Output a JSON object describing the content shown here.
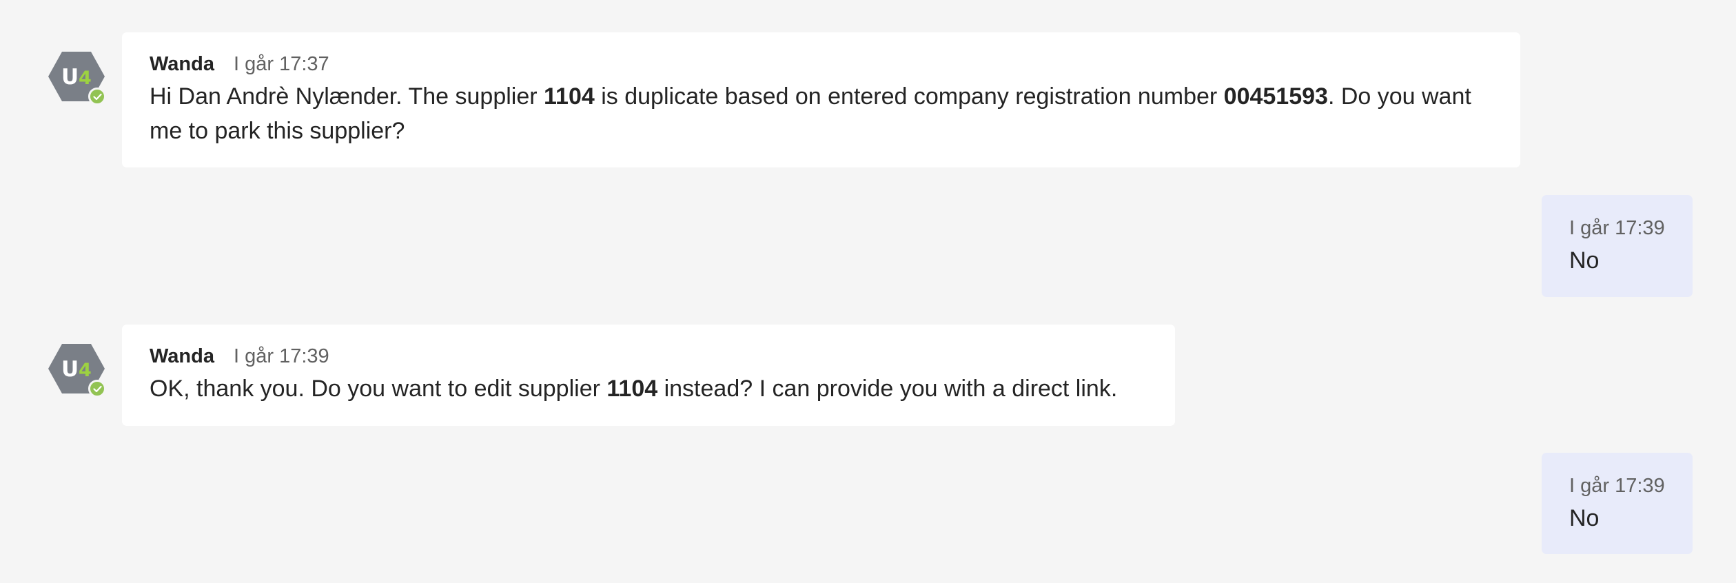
{
  "colors": {
    "page_bg": "#f5f5f5",
    "incoming_bubble": "#ffffff",
    "outgoing_bubble": "#e8ebfa",
    "avatar_hex": "#7a7f87",
    "avatar_accent": "#9dd241",
    "presence_available": "#92c353"
  },
  "avatar": {
    "initials_u": "U",
    "initials_4": "4",
    "status": "available"
  },
  "messages": [
    {
      "direction": "incoming",
      "sender": "Wanda",
      "time": "I går 17:37",
      "parts": {
        "p1": "Hi Dan Andrè Nylænder. The supplier ",
        "b1": "1104",
        "p2": " is duplicate based on entered company registration number ",
        "b2": "00451593",
        "p3": ". Do you want me to park this supplier?"
      }
    },
    {
      "direction": "outgoing",
      "time": "I går 17:39",
      "text": "No"
    },
    {
      "direction": "incoming",
      "sender": "Wanda",
      "time": "I går 17:39",
      "parts": {
        "p1": "OK, thank you. Do you want to edit supplier ",
        "b1": "1104",
        "p2": " instead? I can provide you with a direct link."
      }
    },
    {
      "direction": "outgoing",
      "time": "I går 17:39",
      "text": "No"
    }
  ]
}
